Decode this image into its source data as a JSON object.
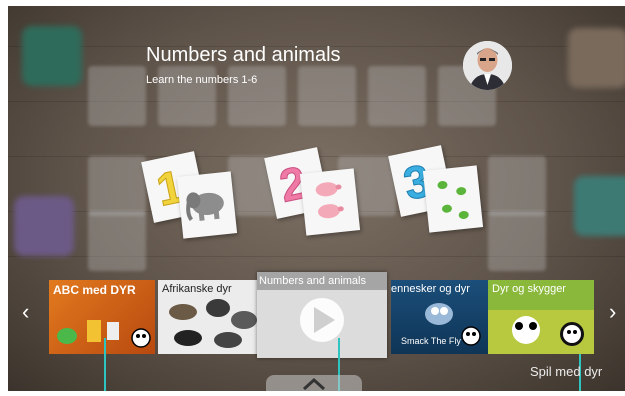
{
  "header": {
    "title": "Numbers and animals",
    "subtitle": "Learn the numbers 1-6"
  },
  "cards": [
    {
      "number": "1",
      "animal": "elephant",
      "number_color": "#f1d43b"
    },
    {
      "number": "2",
      "animal": "pig",
      "number_color": "#f07aa6"
    },
    {
      "number": "3",
      "animal": "frog",
      "number_color": "#3aaee0"
    }
  ],
  "strip": {
    "prev_icon": "‹",
    "next_icon": "›",
    "items": [
      {
        "label": "ABC med DYR",
        "color": "#d9631b"
      },
      {
        "label": "Afrikanske dyr",
        "color": "#6b6b6b"
      },
      {
        "label": "Numbers and animals",
        "color": "#d8d8d8",
        "selected": true
      },
      {
        "label": "ennesker og dyr",
        "sublabel": "Smack The Fly",
        "color": "#1b4e7a"
      },
      {
        "label": "Dyr og skygger",
        "color": "#8ab83a"
      }
    ]
  },
  "bottom_hint": "Spil med dyr",
  "colors": {
    "accent": "#2ec4c0"
  }
}
